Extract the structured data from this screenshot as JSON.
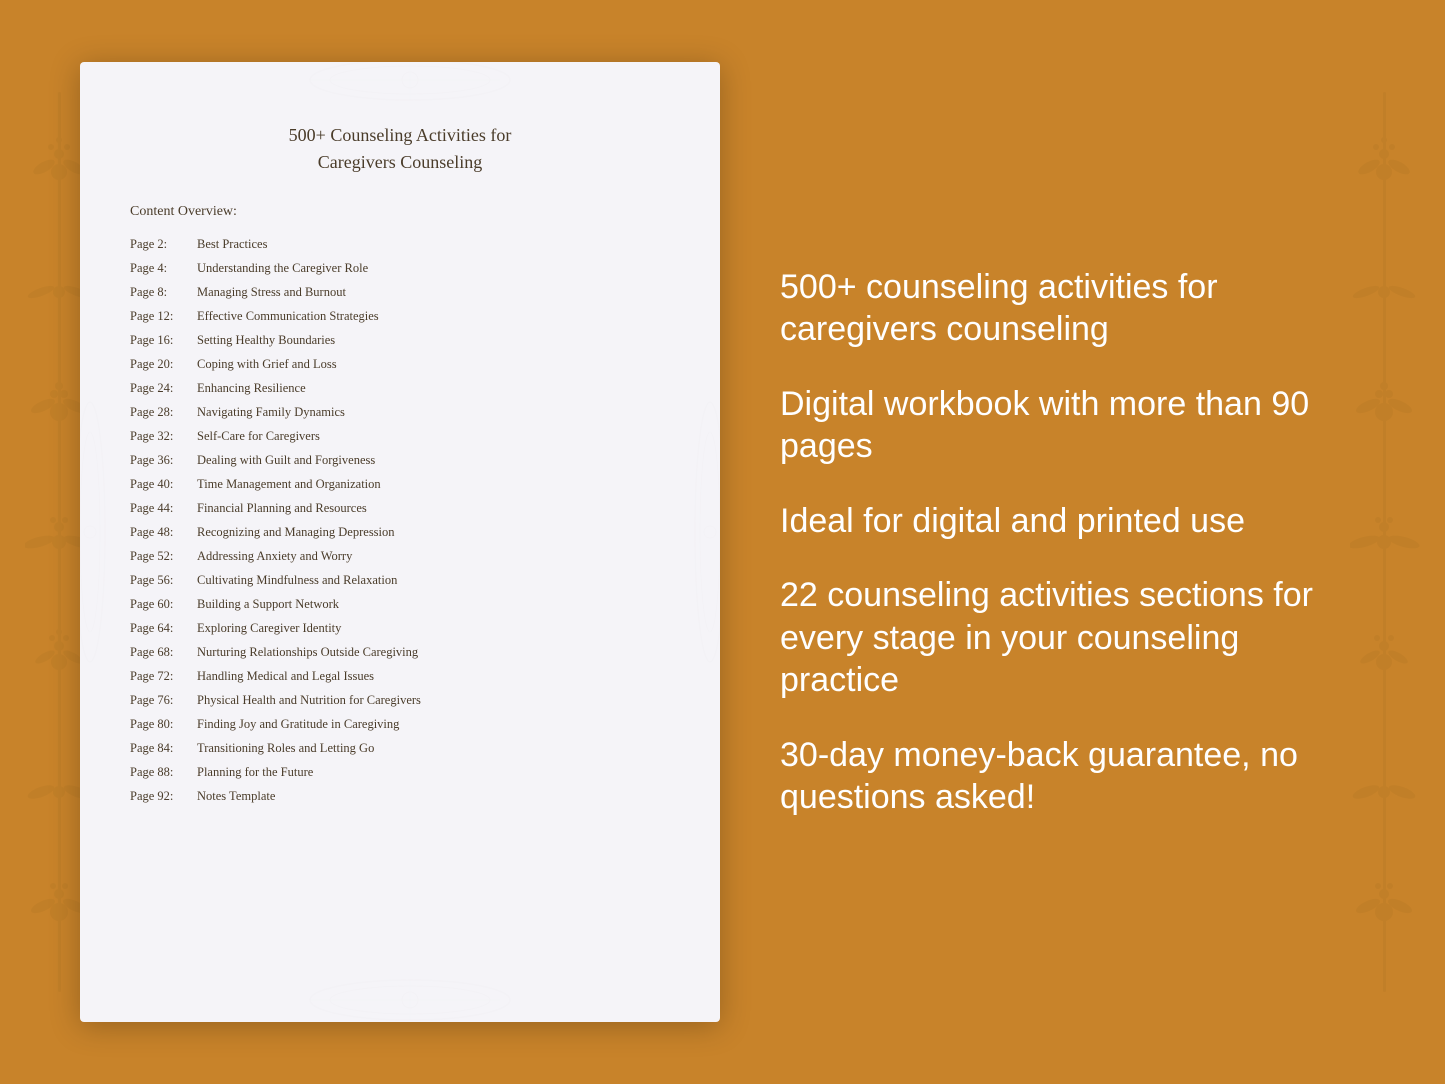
{
  "doc": {
    "title_line1": "500+ Counseling Activities for",
    "title_line2": "Caregivers Counseling",
    "section_label": "Content Overview:",
    "toc": [
      {
        "page": "Page  2:",
        "title": "Best Practices"
      },
      {
        "page": "Page  4:",
        "title": "Understanding the Caregiver Role"
      },
      {
        "page": "Page  8:",
        "title": "Managing Stress and Burnout"
      },
      {
        "page": "Page 12:",
        "title": "Effective Communication Strategies"
      },
      {
        "page": "Page 16:",
        "title": "Setting Healthy Boundaries"
      },
      {
        "page": "Page 20:",
        "title": "Coping with Grief and Loss"
      },
      {
        "page": "Page 24:",
        "title": "Enhancing Resilience"
      },
      {
        "page": "Page 28:",
        "title": "Navigating Family Dynamics"
      },
      {
        "page": "Page 32:",
        "title": "Self-Care for Caregivers"
      },
      {
        "page": "Page 36:",
        "title": "Dealing with Guilt and Forgiveness"
      },
      {
        "page": "Page 40:",
        "title": "Time Management and Organization"
      },
      {
        "page": "Page 44:",
        "title": "Financial Planning and Resources"
      },
      {
        "page": "Page 48:",
        "title": "Recognizing and Managing Depression"
      },
      {
        "page": "Page 52:",
        "title": "Addressing Anxiety and Worry"
      },
      {
        "page": "Page 56:",
        "title": "Cultivating Mindfulness and Relaxation"
      },
      {
        "page": "Page 60:",
        "title": "Building a Support Network"
      },
      {
        "page": "Page 64:",
        "title": "Exploring Caregiver Identity"
      },
      {
        "page": "Page 68:",
        "title": "Nurturing Relationships Outside Caregiving"
      },
      {
        "page": "Page 72:",
        "title": "Handling Medical and Legal Issues"
      },
      {
        "page": "Page 76:",
        "title": "Physical Health and Nutrition for Caregivers"
      },
      {
        "page": "Page 80:",
        "title": "Finding Joy and Gratitude in Caregiving"
      },
      {
        "page": "Page 84:",
        "title": "Transitioning Roles and Letting Go"
      },
      {
        "page": "Page 88:",
        "title": "Planning for the Future"
      },
      {
        "page": "Page 92:",
        "title": "Notes Template"
      }
    ]
  },
  "features": [
    "500+ counseling activities for caregivers counseling",
    "Digital workbook with more than 90 pages",
    "Ideal for digital and printed use",
    "22 counseling activities sections for every stage in your counseling practice",
    "30-day money-back guarantee, no questions asked!"
  ]
}
